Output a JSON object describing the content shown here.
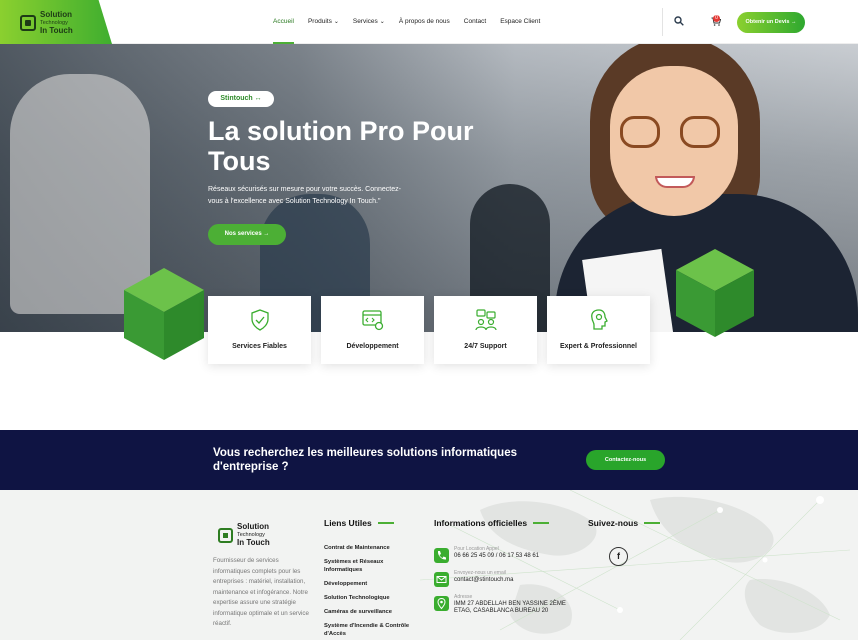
{
  "brand": {
    "line1": "Solution",
    "line2": "Technology",
    "line3": "In Touch"
  },
  "nav": [
    {
      "label": "Accueil",
      "active": true
    },
    {
      "label": "Produits",
      "dropdown": true
    },
    {
      "label": "Services",
      "dropdown": true
    },
    {
      "label": "À propos de nous"
    },
    {
      "label": "Contact"
    },
    {
      "label": "Espace Client"
    }
  ],
  "header": {
    "cart_count": "0",
    "devis_label": "Obtenir un Devis →",
    "icons": [
      "search-icon",
      "cart-icon"
    ]
  },
  "hero": {
    "tag": "Stintouch ↔",
    "title": "La solution Pro Pour Tous",
    "text": "Réseaux sécurisés sur mesure pour votre succès. Connectez-vous à l'excellence avec Solution Technology In Touch.\"",
    "button": "Nos services →"
  },
  "features": [
    {
      "label": "Services Fiables",
      "icon": "shield-icon"
    },
    {
      "label": "Développement",
      "icon": "code-settings-icon"
    },
    {
      "label": "24/7 Support",
      "icon": "team-support-icon"
    },
    {
      "label": "Expert & Professionnel",
      "icon": "brain-gear-icon"
    }
  ],
  "cta": {
    "text": "Vous recherchez les meilleures solutions informatiques d'entreprise ?",
    "button": "Contactez-nous"
  },
  "footer": {
    "description": "Fournisseur de services informatiques complets pour les entreprises : matériel, installation, maintenance et infogérance. Notre expertise assure une stratégie informatique optimale et un service réactif.",
    "links_title": "Liens Utiles",
    "links": [
      "Contrat de Maintenance",
      "Systèmes et Réseaux Informatiques",
      "Développement",
      "Solution Technologique",
      "Caméras de surveillance",
      "Système d'Incendie & Contrôle d'Accès"
    ],
    "info_title": "Informations officielles",
    "info": [
      {
        "label": "Pour Location Appel",
        "value": "06 66 25 45 09 / 06 17 53 48 61",
        "icon": "phone-icon"
      },
      {
        "label": "Envoyez-nous un email",
        "value": "contact@stintouch.ma",
        "icon": "mail-icon"
      },
      {
        "label": "Adresse",
        "value": "IMM 27 ABDELLAH BEN YASSINE 2ÈME ETAG, CASABLANCA BUREAU 20",
        "icon": "location-icon"
      }
    ],
    "social_title": "Suivez-nous",
    "social": [
      {
        "label": "f",
        "icon": "facebook-icon"
      }
    ]
  },
  "colors": {
    "brand_green": "#4caf35",
    "navy": "#0f1443",
    "light_green": "#8bd02f"
  }
}
